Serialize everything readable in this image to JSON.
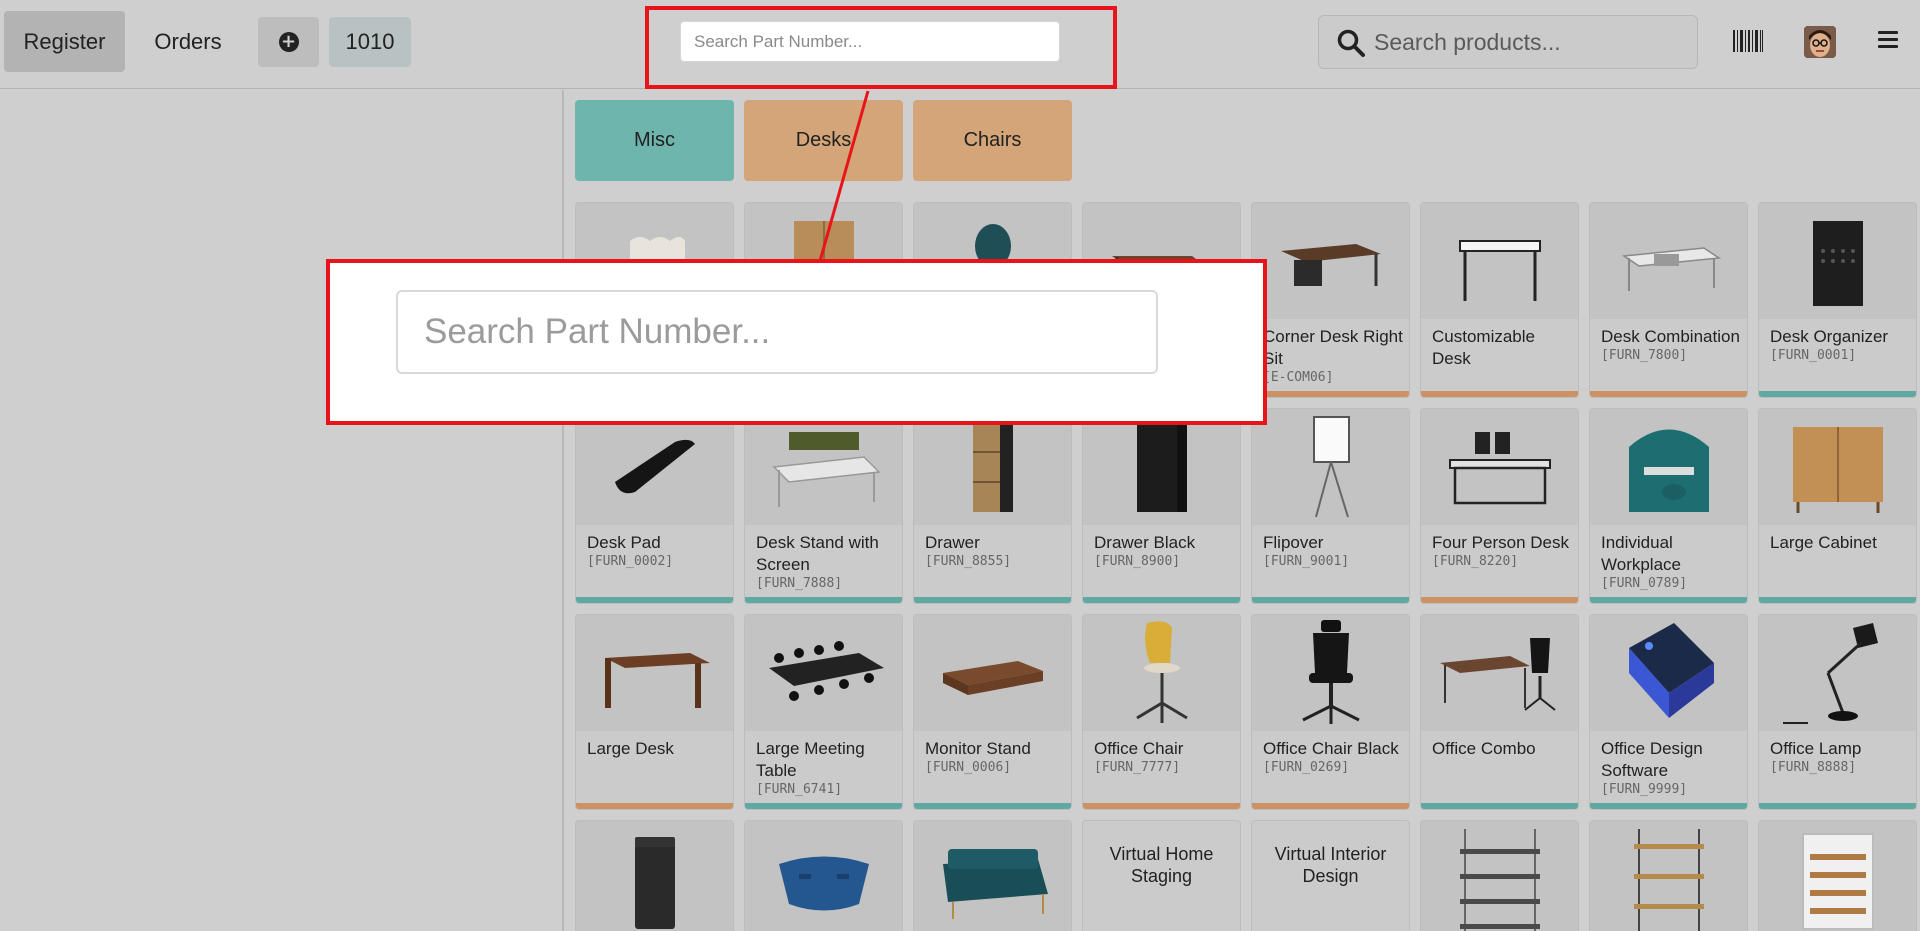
{
  "topbar": {
    "register_label": "Register",
    "orders_label": "Orders",
    "order_number": "1010",
    "part_search_placeholder": "Search Part Number...",
    "product_search_placeholder": "Search products..."
  },
  "categories": [
    {
      "label": "Misc",
      "color": "#6eb5ae"
    },
    {
      "label": "Desks",
      "color": "#d4a579"
    },
    {
      "label": "Chairs",
      "color": "#d4a579"
    }
  ],
  "products": {
    "row1": [
      {
        "name": "Corner Desk Right Sit",
        "ref": "[E-COM06]",
        "bar": "orange"
      },
      {
        "name": "Customizable Desk",
        "ref": "",
        "bar": "orange"
      },
      {
        "name": "Desk Combination",
        "ref": "[FURN_7800]",
        "bar": "orange"
      },
      {
        "name": "Desk Organizer",
        "ref": "[FURN_0001]",
        "bar": "teal"
      }
    ],
    "row2": [
      {
        "name": "Desk Pad",
        "ref": "[FURN_0002]",
        "bar": "teal"
      },
      {
        "name": "Desk Stand with Screen",
        "ref": "[FURN_7888]",
        "bar": "teal"
      },
      {
        "name": "Drawer",
        "ref": "[FURN_8855]",
        "bar": "teal"
      },
      {
        "name": "Drawer Black",
        "ref": "[FURN_8900]",
        "bar": "teal"
      },
      {
        "name": "Flipover",
        "ref": "[FURN_9001]",
        "bar": "teal"
      },
      {
        "name": "Four Person Desk",
        "ref": "[FURN_8220]",
        "bar": "orange"
      },
      {
        "name": "Individual Workplace",
        "ref": "[FURN_0789]",
        "bar": "teal"
      },
      {
        "name": "Large Cabinet",
        "ref": "",
        "bar": "teal"
      }
    ],
    "row3": [
      {
        "name": "Large Desk",
        "ref": "",
        "bar": "orange"
      },
      {
        "name": "Large Meeting Table",
        "ref": "[FURN_6741]",
        "bar": "teal"
      },
      {
        "name": "Monitor Stand",
        "ref": "[FURN_0006]",
        "bar": "teal"
      },
      {
        "name": "Office Chair",
        "ref": "[FURN_7777]",
        "bar": "orange"
      },
      {
        "name": "Office Chair Black",
        "ref": "[FURN_0269]",
        "bar": "orange"
      },
      {
        "name": "Office Combo",
        "ref": "",
        "bar": "teal"
      },
      {
        "name": "Office Design Software",
        "ref": "[FURN_9999]",
        "bar": "teal"
      },
      {
        "name": "Office Lamp",
        "ref": "[FURN_8888]",
        "bar": "teal"
      }
    ],
    "row4": [
      {
        "name": "Virtual Home Staging"
      },
      {
        "name": "Virtual Interior Design"
      }
    ]
  },
  "colors": {
    "teal": "#5fa9a2",
    "orange": "#cc9265",
    "callout_red": "#e8141a"
  }
}
